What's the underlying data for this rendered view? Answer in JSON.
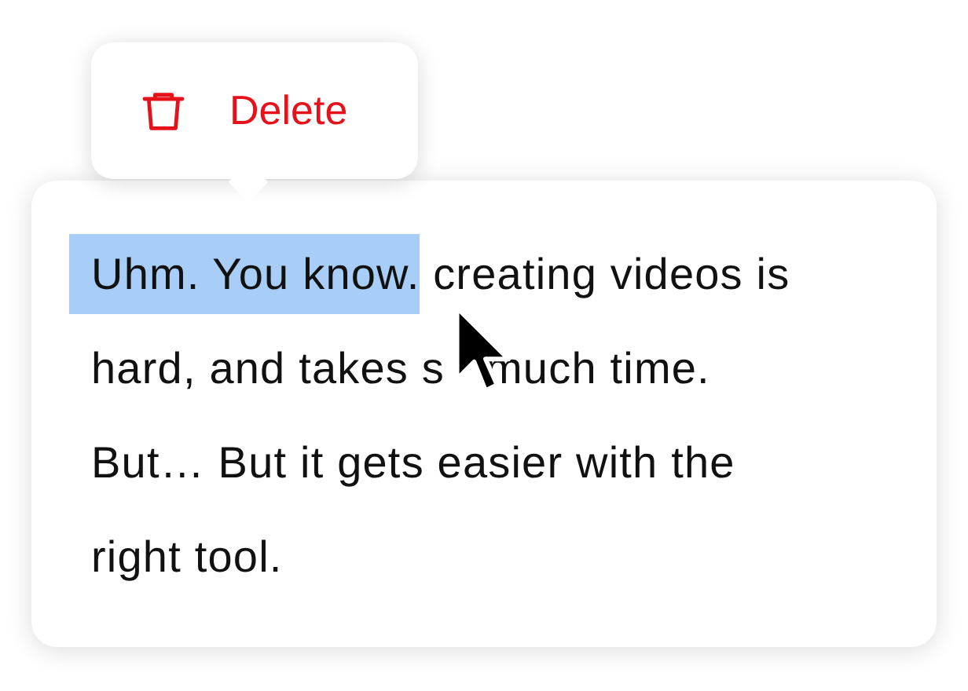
{
  "popup": {
    "action": "Delete"
  },
  "paragraph": {
    "selection": "Uhm. You know.",
    "lines": [
      [
        " creating videos is"
      ],
      [
        "hard, and takes s",
        "much time."
      ],
      [
        "But… But it gets easier with the"
      ],
      [
        "right tool."
      ]
    ]
  }
}
